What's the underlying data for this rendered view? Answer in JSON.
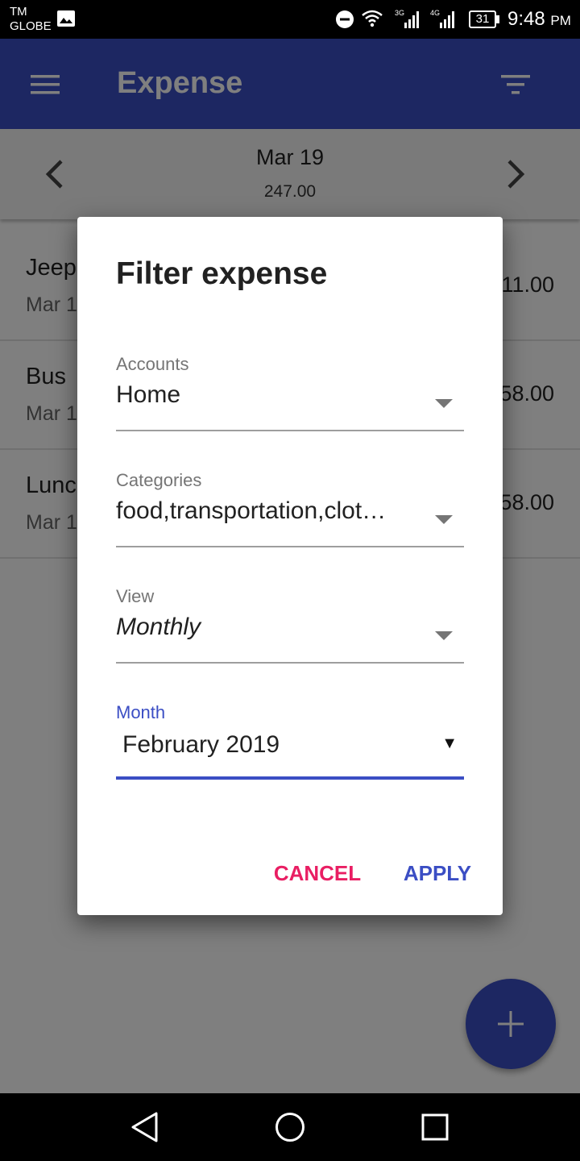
{
  "status_bar": {
    "carrier_line1": "TM",
    "carrier_line2": "GLOBE",
    "network_1": "3G",
    "network_2": "4G",
    "battery": "31",
    "time": "9:48",
    "ampm": "PM"
  },
  "app_bar": {
    "title": "Expense",
    "menu_icon": "hamburger-menu-icon",
    "filter_icon": "filter-list-icon"
  },
  "date_nav": {
    "date": "Mar 19",
    "total": "247.00"
  },
  "expenses": [
    {
      "name": "Jeep",
      "date": "Mar 1",
      "amount": "11.00"
    },
    {
      "name": "Bus",
      "date": "Mar 1",
      "amount": "58.00"
    },
    {
      "name": "Lunc",
      "date": "Mar 1",
      "amount": "58.00"
    }
  ],
  "dialog": {
    "title": "Filter expense",
    "accounts_label": "Accounts",
    "accounts_value": "Home",
    "categories_label": "Categories",
    "categories_value": "food,transportation,clot…",
    "view_label": "View",
    "view_value": "Monthly",
    "month_label": "Month",
    "month_value": "February 2019",
    "month_arrow": "▼",
    "cancel_label": "CANCEL",
    "apply_label": "APPLY"
  },
  "colors": {
    "primary": "#3b4ec4",
    "accent": "#e91e63"
  }
}
